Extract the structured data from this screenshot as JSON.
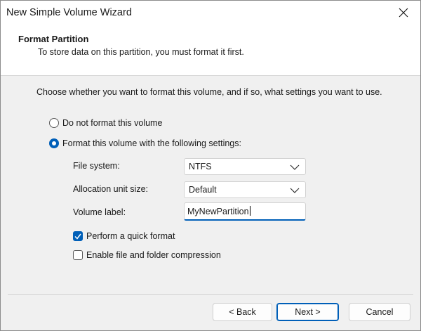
{
  "window": {
    "title": "New Simple Volume Wizard",
    "close_icon": "close-icon"
  },
  "header": {
    "title": "Format Partition",
    "subtitle": "To store data on this partition, you must format it first."
  },
  "body": {
    "intro": "Choose whether you want to format this volume, and if so, what settings you want to use.",
    "radio_no_format": {
      "label": "Do not format this volume",
      "checked": false
    },
    "radio_format": {
      "label": "Format this volume with the following settings:",
      "checked": true
    },
    "file_system": {
      "label": "File system:",
      "value": "NTFS"
    },
    "allocation_unit": {
      "label": "Allocation unit size:",
      "value": "Default"
    },
    "volume_label": {
      "label": "Volume label:",
      "value": "MyNewPartition"
    },
    "quick_format": {
      "label": "Perform a quick format",
      "checked": true
    },
    "compression": {
      "label": "Enable file and folder compression",
      "checked": false
    }
  },
  "footer": {
    "back_label": "< Back",
    "next_label": "Next >",
    "cancel_label": "Cancel"
  },
  "colors": {
    "accent": "#005fb8",
    "window_bg": "#f0f0f0",
    "panel_bg": "#ffffff"
  }
}
